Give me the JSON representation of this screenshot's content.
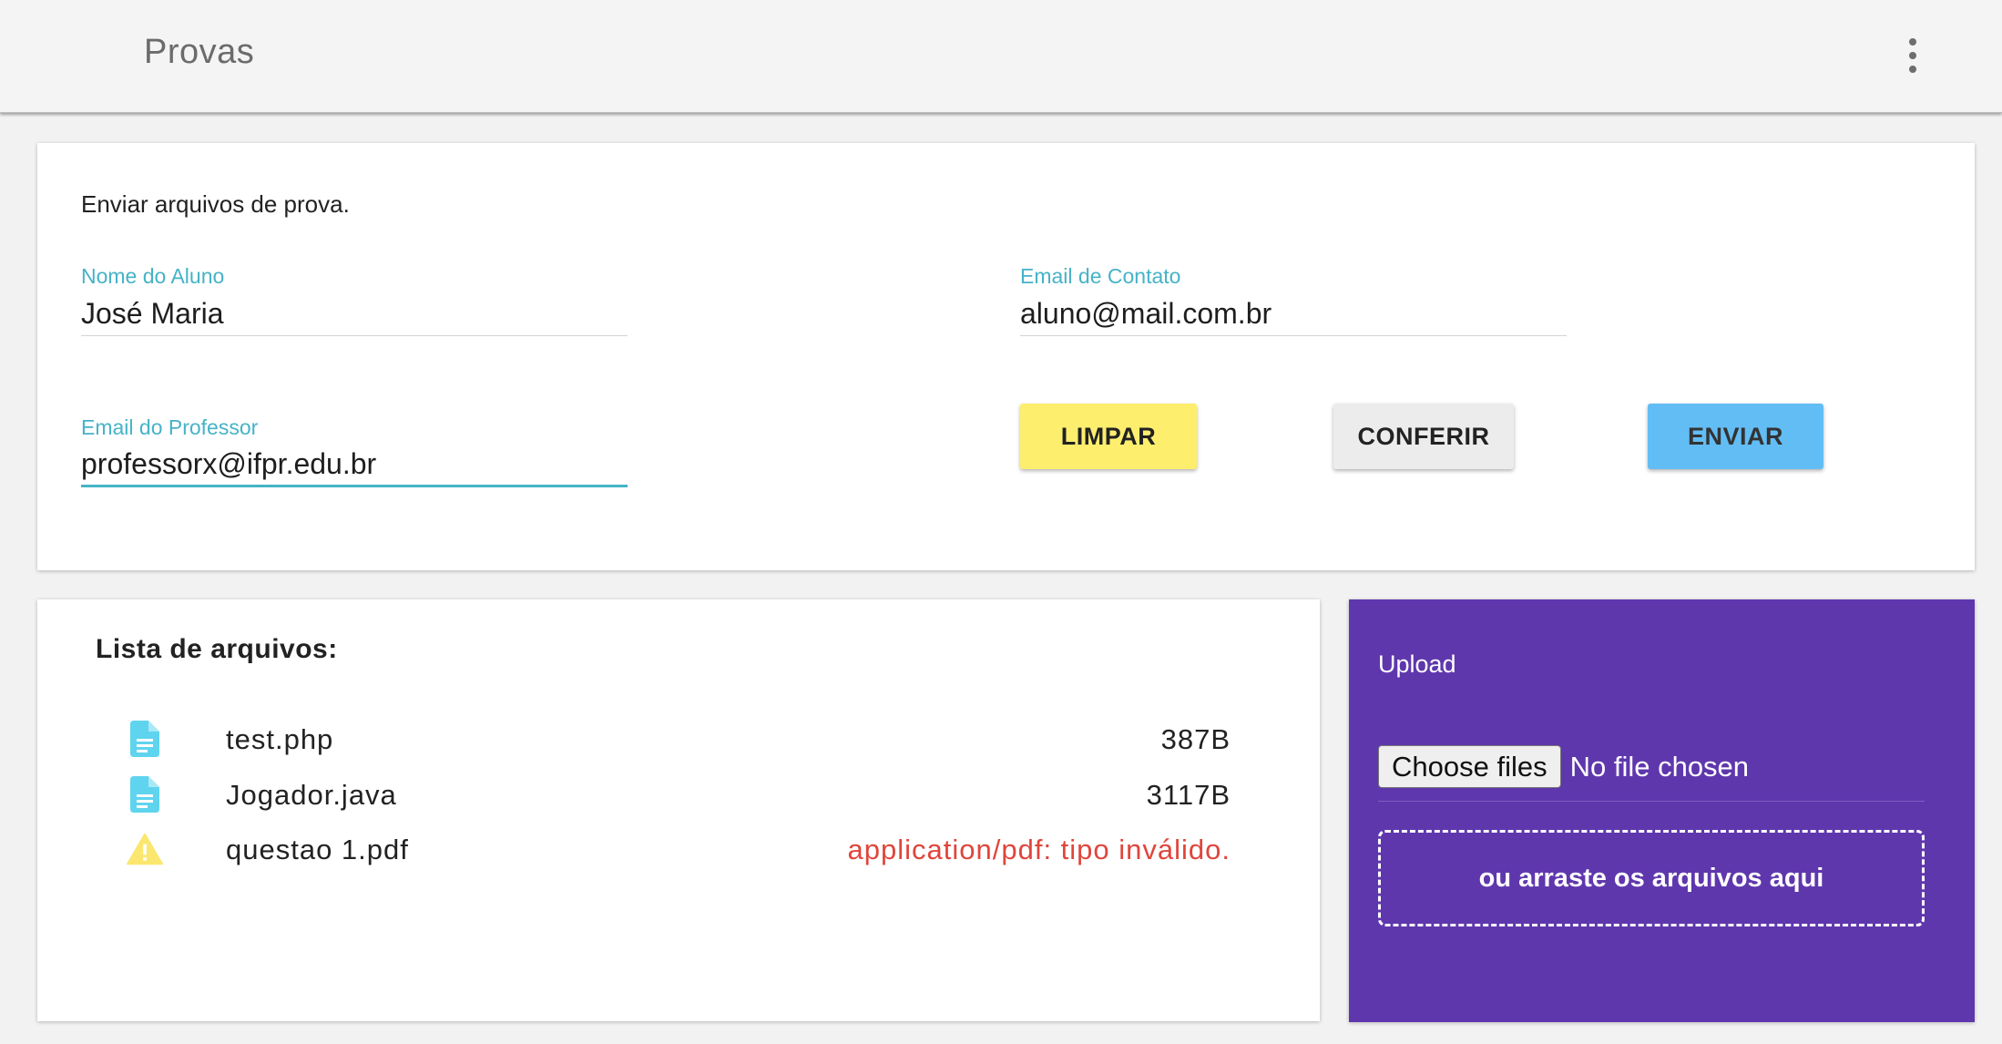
{
  "toolbar": {
    "title": "Provas",
    "menu_icon": "more-vert-icon"
  },
  "form": {
    "intro": "Enviar arquivos de prova.",
    "nome": {
      "label": "Nome do Aluno",
      "value": "José Maria"
    },
    "contato": {
      "label": "Email de Contato",
      "value": "aluno@mail.com.br"
    },
    "professor": {
      "label": "Email do Professor",
      "value": "professorx@ifpr.edu.br"
    },
    "buttons": {
      "limpar": "LIMPAR",
      "conferir": "CONFERIR",
      "enviar": "ENVIAR"
    }
  },
  "list": {
    "title": "Lista de arquivos:",
    "files": [
      {
        "name": "test.php",
        "size": "387B",
        "icon": "document-icon",
        "status": "ok"
      },
      {
        "name": "Jogador.java",
        "size": "3117B",
        "icon": "document-icon",
        "status": "ok"
      },
      {
        "name": "questao 1.pdf",
        "size": "application/pdf: tipo inválido.",
        "icon": "warning-icon",
        "status": "error"
      }
    ]
  },
  "upload": {
    "title": "Upload",
    "choose_label": "Choose files",
    "no_file": "No file chosen",
    "drop_text": "ou arraste os arquivos aqui"
  },
  "colors": {
    "accent": "#46b3c7",
    "limpar": "#fdee6e",
    "conferir": "#ececec",
    "enviar": "#62bdf5",
    "upload_bg": "#5f37ad",
    "error": "#e0453b",
    "doc_icon": "#5fd4ee",
    "warning_icon": "#fbe76f"
  }
}
